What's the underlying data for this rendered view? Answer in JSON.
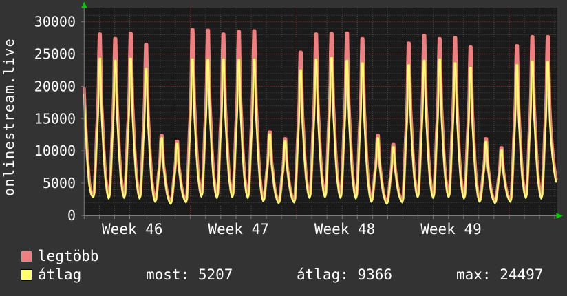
{
  "page": {
    "background": "#333333",
    "plot_background": "#1b1b1b"
  },
  "title": {
    "vertical_text": "onlinestream.live"
  },
  "chart_data": {
    "type": "line",
    "title": "onlinestream.live",
    "x_labels": [
      "Week 46",
      "Week 47",
      "Week 48",
      "Week 49"
    ],
    "y_ticks": [
      0,
      5000,
      10000,
      15000,
      20000,
      25000,
      30000
    ],
    "y_minor_step": 1000,
    "ylim": [
      0,
      31500
    ],
    "num_days": 30,
    "grid": {
      "major_color": "#b03434",
      "minor_color": "#4d4d4d",
      "axis_color": "#7d7d7d",
      "arrow_color": "#00cc00"
    },
    "legend_position": "bottom-left",
    "series": [
      {
        "name": "legtöbb",
        "color": "#f08080",
        "peaks": [
          28100,
          27400,
          28200,
          26500,
          12400,
          11500,
          28800,
          28700,
          28100,
          28500,
          28600,
          12950,
          11900,
          25300,
          28100,
          28200,
          28250,
          27400,
          12400,
          11000,
          26700,
          27900,
          27400,
          27550,
          26100,
          11900,
          10500,
          26300,
          27700,
          27700
        ],
        "troughs": [
          3050,
          2850,
          2950,
          2850,
          2350,
          2050,
          2250,
          3150,
          2950,
          3050,
          2950,
          2450,
          2150,
          2250,
          2950,
          3050,
          2950,
          2850,
          2350,
          2050,
          2250,
          3050,
          2950,
          3050,
          2850,
          2350,
          2150,
          2350,
          2950,
          2850,
          2850
        ],
        "start_points": [
          [
            122.3,
            19700
          ],
          [
            124.3,
            14600
          ],
          [
            127.0,
            9200
          ],
          [
            130.0,
            5100
          ],
          [
            132.5,
            3550
          ]
        ],
        "end_value": 5650
      },
      {
        "name": "átlag",
        "color": "#ffff6e",
        "peaks": [
          24300,
          24000,
          24300,
          22700,
          12000,
          11100,
          24200,
          24100,
          24200,
          24100,
          24200,
          12600,
          11500,
          22500,
          24150,
          24400,
          24000,
          23600,
          12000,
          10600,
          23300,
          24000,
          24200,
          23600,
          22900,
          11400,
          10100,
          23300,
          23900,
          23800
        ],
        "troughs": [
          2800,
          2600,
          2700,
          2600,
          2100,
          1800,
          2000,
          2900,
          2700,
          2800,
          2700,
          2200,
          1900,
          2000,
          2700,
          2800,
          2700,
          2600,
          2100,
          1800,
          2000,
          2800,
          2700,
          2800,
          2600,
          2100,
          1900,
          2100,
          2700,
          2600,
          2600
        ],
        "start_points": [
          [
            122.3,
            18800
          ],
          [
            124.3,
            13800
          ],
          [
            126.8,
            8600
          ],
          [
            129.8,
            4600
          ],
          [
            132.5,
            3200
          ]
        ],
        "end_value": 5207
      }
    ],
    "waveform": {
      "rise_peak_frac": 0.39,
      "points": [
        [
          0,
          0
        ],
        [
          0.06,
          0.02
        ],
        [
          0.14,
          0.18
        ],
        [
          0.22,
          0.4
        ],
        [
          0.275,
          0.5
        ],
        [
          0.33,
          0.68
        ],
        [
          0.36,
          0.88
        ],
        [
          0.39,
          1.0
        ],
        [
          0.46,
          1.0
        ],
        [
          0.505,
          0.78
        ],
        [
          0.55,
          0.575
        ],
        [
          0.615,
          0.45
        ],
        [
          0.69,
          0.29
        ],
        [
          0.8,
          0.125
        ],
        [
          0.92,
          0.03
        ]
      ],
      "tail_points": [
        [
          0.615,
          0.45
        ],
        [
          0.72,
          0.31
        ],
        [
          0.82,
          0.21
        ],
        [
          0.9,
          0.15
        ],
        [
          0.965,
          0.123
        ]
      ]
    },
    "stats": {
      "now": 5207,
      "avg": 9366,
      "max": 24497
    }
  },
  "legend": {
    "items": [
      {
        "label": "legtöbb",
        "color": "#f08080"
      },
      {
        "label": "átlag",
        "color": "#ffff6e"
      }
    ]
  },
  "stats": {
    "most": "most: 5207",
    "avg": "átlag: 9366",
    "max": "max: 24497"
  }
}
